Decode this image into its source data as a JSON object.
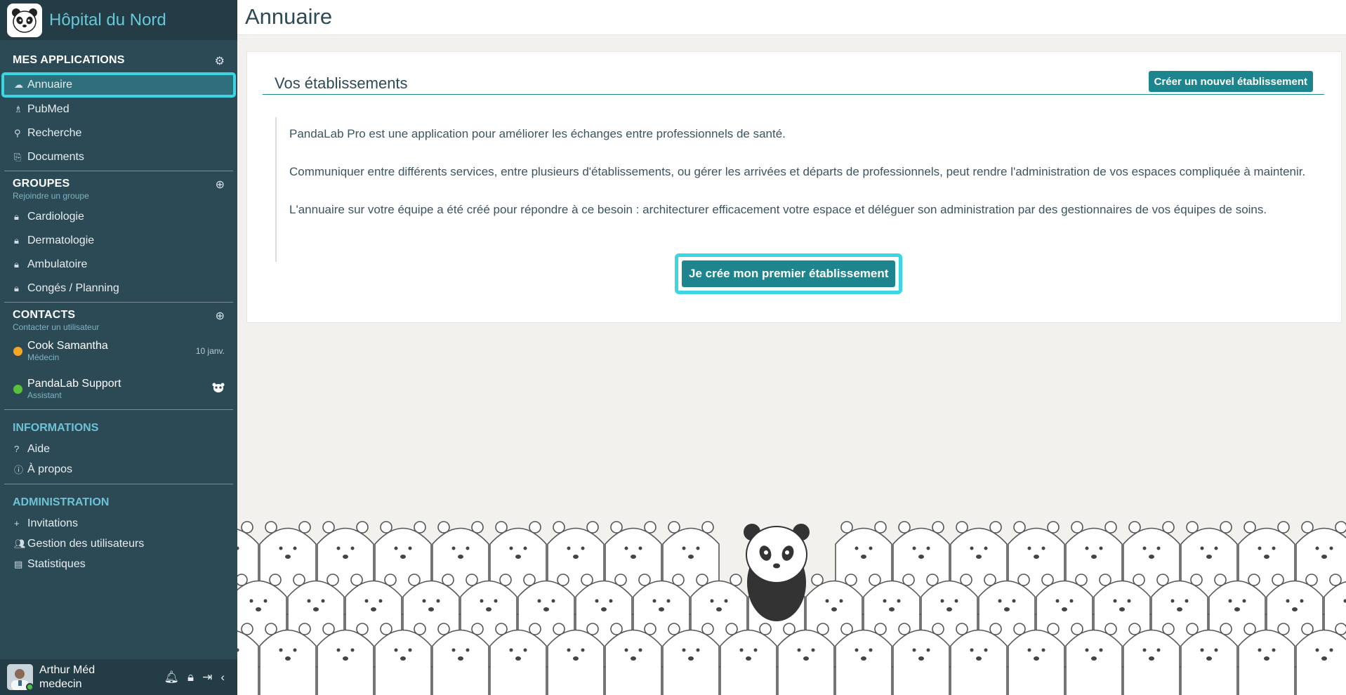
{
  "sidebar": {
    "hospital_name": "Hôpital du Nord",
    "apps": {
      "title": "MES APPLICATIONS",
      "items": [
        {
          "label": "Annuaire",
          "icon": "cloud-icon",
          "active": true
        },
        {
          "label": "PubMed",
          "icon": "pubmed-icon"
        },
        {
          "label": "Recherche",
          "icon": "search-icon"
        },
        {
          "label": "Documents",
          "icon": "paperclip-icon"
        }
      ]
    },
    "groups": {
      "title": "GROUPES",
      "subtitle": "Rejoindre un groupe",
      "items": [
        {
          "label": "Cardiologie",
          "icon": "lock-icon"
        },
        {
          "label": "Dermatologie",
          "icon": "lock-icon"
        },
        {
          "label": "Ambulatoire",
          "icon": "lock-icon"
        },
        {
          "label": "Congés / Planning",
          "icon": "lock-icon"
        }
      ]
    },
    "contacts": {
      "title": "CONTACTS",
      "subtitle": "Contacter un utilisateur",
      "items": [
        {
          "name": "Cook Samantha",
          "role": "Médecin",
          "meta": "10 janv.",
          "status_color": "#f5a623"
        },
        {
          "name": "PandaLab Support",
          "role": "Assistant",
          "meta_icon": "panda-icon",
          "status_color": "#58c33a"
        }
      ]
    },
    "informations": {
      "title": "INFORMATIONS",
      "items": [
        {
          "label": "Aide",
          "icon": "question-icon"
        },
        {
          "label": "À propos",
          "icon": "info-icon"
        }
      ]
    },
    "administration": {
      "title": "ADMINISTRATION",
      "items": [
        {
          "label": "Invitations",
          "icon": "plus-icon"
        },
        {
          "label": "Gestion des utilisateurs",
          "icon": "users-icon"
        },
        {
          "label": "Statistiques",
          "icon": "stats-icon"
        }
      ]
    },
    "user": {
      "name": "Arthur Méd",
      "role": "medecin"
    }
  },
  "header": {
    "title": "Annuaire"
  },
  "card": {
    "title": "Vos établissements",
    "create_button": "Créer un nouvel établissement",
    "paragraphs": [
      "PandaLab Pro est une application pour améliorer les échanges entre professionnels de santé.",
      "Communiquer entre différents services, entre plusieurs d'établissements, ou gérer les arrivées et départs de professionnels, peut rendre l'administration de vos espaces compliquée à maintenir.",
      "L'annuaire sur votre équipe a été créé pour répondre à ce besoin : architecturer efficacement votre espace et déléguer son administration par des gestionnaires de vos équipes de soins."
    ],
    "cta_button": "Je crée mon premier établissement"
  },
  "colors": {
    "sidebar_bg": "#2c4a56",
    "accent": "#1d858d",
    "highlight": "#3ad6e3"
  }
}
